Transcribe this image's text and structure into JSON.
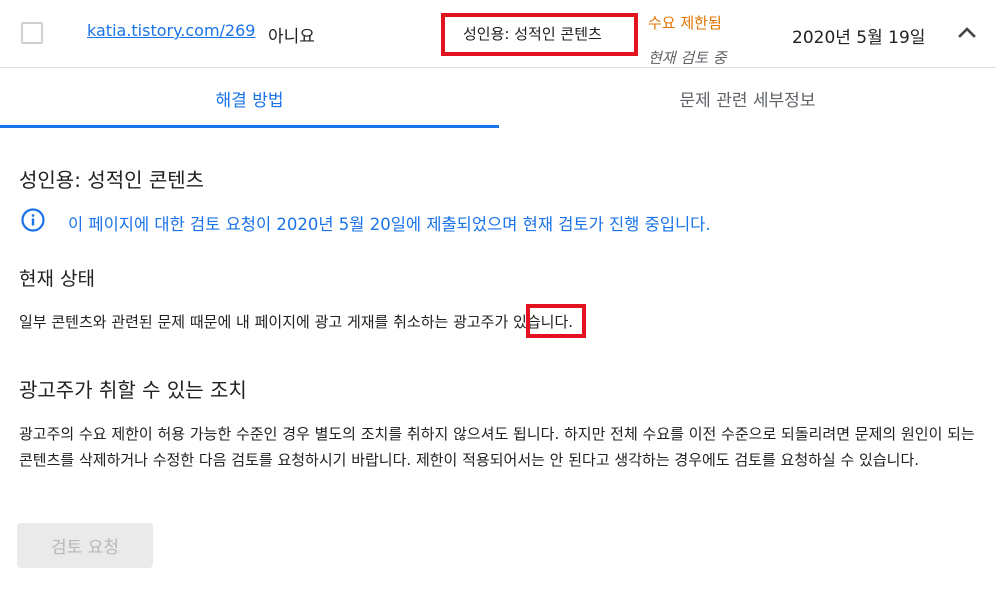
{
  "row": {
    "url": "katia.tistory.com/269",
    "answer": "아니요",
    "issue": "성인용: 성적인 콘텐츠",
    "status": "수요 제한됨",
    "review_status": "현재 검토 중",
    "date": "2020년 5월 19일"
  },
  "tabs": [
    {
      "label": "해결 방법",
      "active": true
    },
    {
      "label": "문제 관련 세부정보",
      "active": false
    }
  ],
  "detail": {
    "title": "성인용: 성적인 콘텐츠",
    "info": "이 페이지에 대한 검토 요청이 2020년 5월 20일에 제출되었으며 현재 검토가 진행 중입니다.",
    "current_status_heading": "현재 상태",
    "current_status_text": "일부 콘텐츠와 관련된 문제 때문에 내 페이지에 광고 게재를 취소하는 광고주가 있습니다.",
    "action_heading": "광고주가 취할 수 있는 조치",
    "action_text": "광고주의 수요 제한이 허용 가능한 수준인 경우 별도의 조치를 취하지 않으셔도 됩니다. 하지만 전체 수요를 이전 수준으로 되돌리려면 문제의 원인이 되는 콘텐츠를 삭제하거나 수정한 다음 검토를 요청하시기 바랍니다. 제한이 적용되어서는 안 된다고 생각하는 경우에도 검토를 요청하실 수 있습니다.",
    "review_button": "검토 요청"
  },
  "colors": {
    "accent": "#1a73e8",
    "warning": "#e37400",
    "annotation": "#e2131f"
  },
  "icons": {
    "info": "info-circle-icon",
    "collapse": "chevron-up-icon"
  }
}
